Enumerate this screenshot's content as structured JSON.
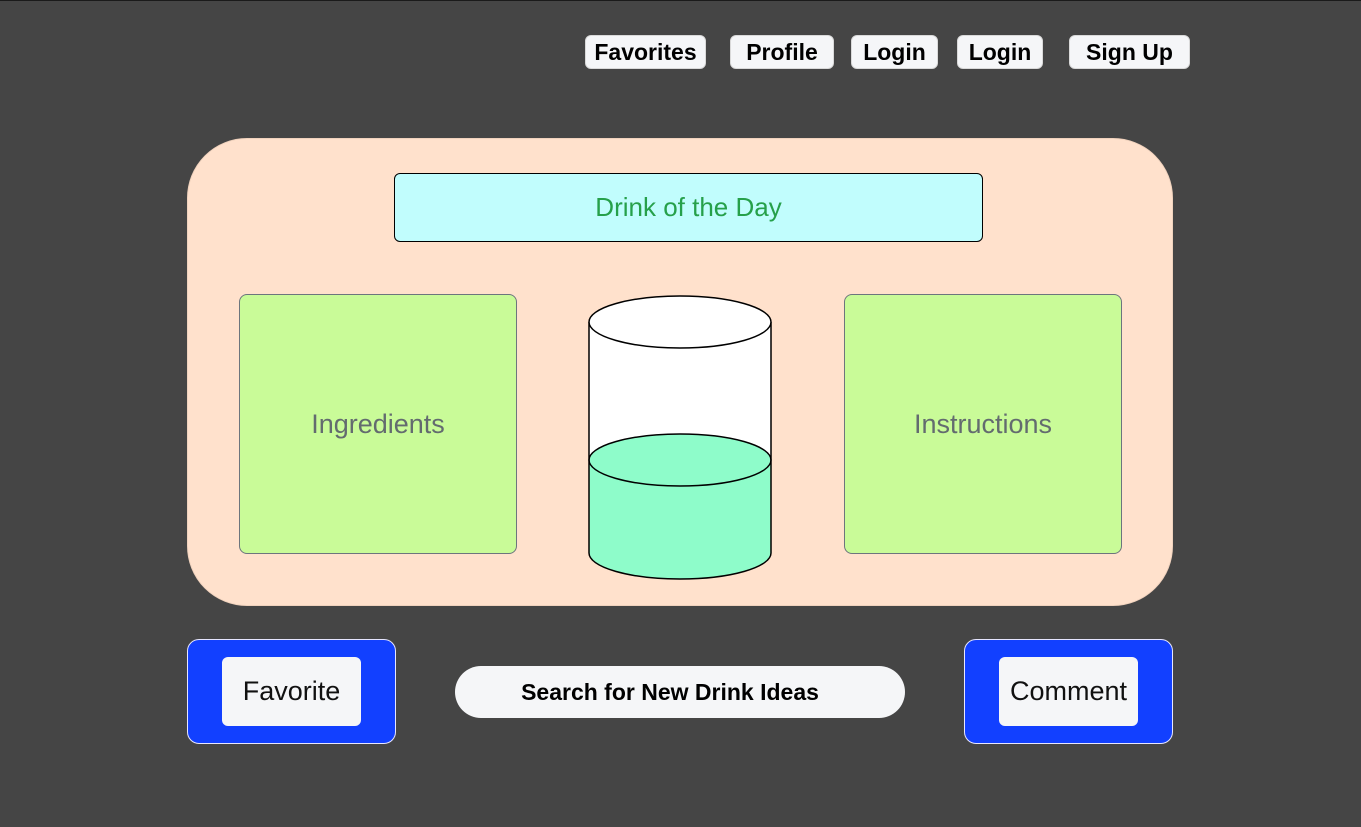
{
  "nav": {
    "items": [
      {
        "label": "Favorites"
      },
      {
        "label": "Profile"
      },
      {
        "label": "Login"
      },
      {
        "label": "Login"
      },
      {
        "label": "Sign Up"
      }
    ]
  },
  "main": {
    "title": "Drink of the Day",
    "left_panel_label": "Ingredients",
    "right_panel_label": "Instructions",
    "glass": {
      "icon": "glass-icon",
      "liquid_color": "#8efcca"
    }
  },
  "actions": {
    "favorite_label": "Favorite",
    "search_label": "Search for New Drink Ideas",
    "comment_label": "Comment"
  },
  "colors": {
    "background": "#454545",
    "panel": "#ffe1cc",
    "title_bg": "#c1fdfd",
    "title_text": "#26a04a",
    "box_bg": "#c9fb98",
    "accent_blue": "#1240ff"
  }
}
